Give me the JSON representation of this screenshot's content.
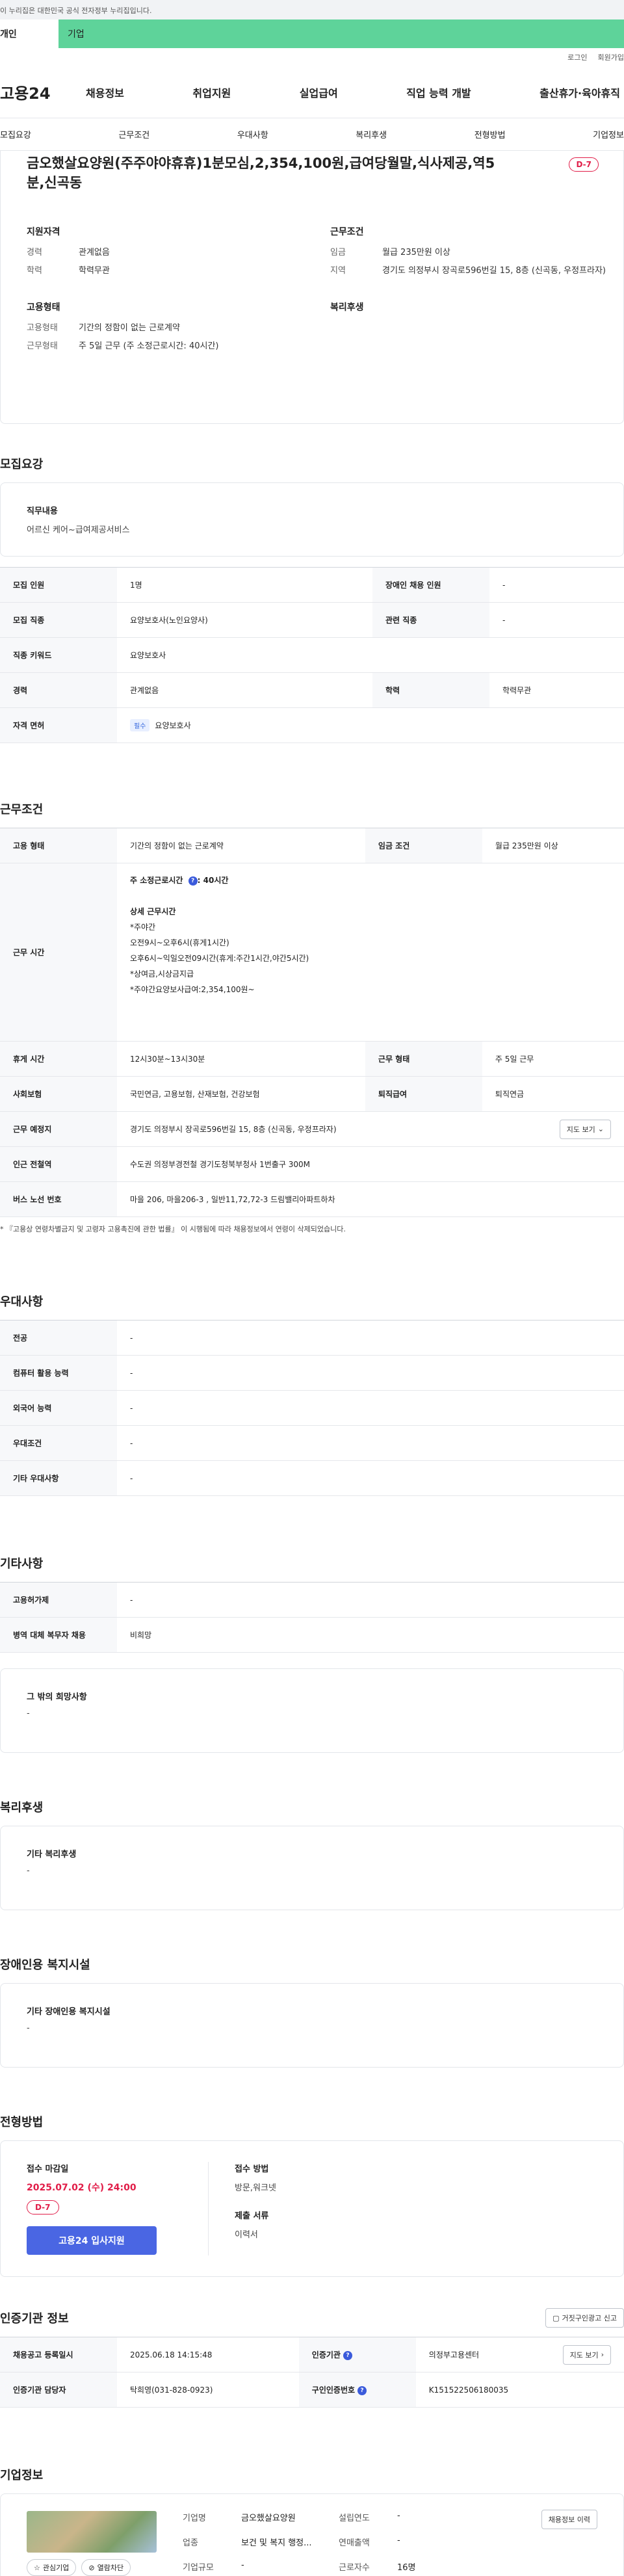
{
  "topbar": {
    "notice": "이 누리집은 대한민국 공식 전자정부 누리집입니다."
  },
  "gnb": {
    "individual": "개인",
    "corporate": "기업"
  },
  "util": {
    "login": "로그인",
    "signup": "회원가입"
  },
  "header": {
    "logo": "고용24",
    "menu": [
      "채용정보",
      "취업지원",
      "실업급여",
      "직업 능력 개발",
      "출산휴가·육아휴직"
    ]
  },
  "anchors": [
    "모집요강",
    "근무조건",
    "우대사항",
    "복리후생",
    "전형방법",
    "기업정보"
  ],
  "summary": {
    "title": "금오했살요양원(주주야야휴휴)1분모심,2,354,100원,급여당월말,식사제공,역5분,신곡동",
    "dday": "D-7",
    "qual_title": "지원자격",
    "qual": [
      {
        "k": "경력",
        "v": "관계없음"
      },
      {
        "k": "학력",
        "v": "학력무관"
      }
    ],
    "cond_title": "근무조건",
    "cond": [
      {
        "k": "임금",
        "v": "월급 235만원 이상"
      },
      {
        "k": "지역",
        "v": "경기도 의정부시 장곡로596번길 15, 8층 (신곡동, 우정프라자)"
      }
    ],
    "emp_title": "고용형태",
    "emp": [
      {
        "k": "고용형태",
        "v": "기간의 정함이 없는 근로계약"
      },
      {
        "k": "근무형태",
        "v": "주 5일 근무 (주 소정근로시간: 40시간)"
      }
    ],
    "welfare_title": "복리후생"
  },
  "recruit": {
    "section": "모집요강",
    "duty_label": "직무내용",
    "duty_value": "어르신 케어~급여제공서비스",
    "rows": {
      "count_k": "모집 인원",
      "count_v": "1명",
      "disabled_k": "장애인 채용 인원",
      "disabled_v": "-",
      "job_k": "모집 직종",
      "job_v": "요양보호사(노인요양사)",
      "related_k": "관련 직종",
      "related_v": "-",
      "kw_k": "직종 키워드",
      "kw_v": "요양보호사",
      "career_k": "경력",
      "career_v": "관계없음",
      "edu_k": "학력",
      "edu_v": "학력무관",
      "license_k": "자격 면허",
      "license_badge": "필수",
      "license_v": "요양보호사"
    }
  },
  "work": {
    "section": "근무조건",
    "emp_k": "고용 형태",
    "emp_v": "기간의 정함이 없는 근로계약",
    "wage_k": "임금 조건",
    "wage_v": "월급 235만원 이상",
    "hours_k": "근무 시간",
    "hours_week_label": "주 소정근로시간",
    "hours_week_value": ": 40시간",
    "hours_detail_title": "상세 근무시간",
    "hours_lines": [
      "*주야간",
      "오전9시~오후6시(휴게1시간)",
      "오후6시~익일오전09시간(휴게:주간1시간,야간5시간)",
      "*상여금,시상금지급",
      "*주야간요양보사급여:2,354,100원~"
    ],
    "rest_k": "휴게 시간",
    "rest_v": "12시30분~13시30분",
    "worktype_k": "근무 형태",
    "worktype_v": "주 5일 근무",
    "insurance_k": "사회보험",
    "insurance_v": "국민연금, 고용보험, 산재보험, 건강보험",
    "retire_k": "퇴직급여",
    "retire_v": "퇴직연금",
    "place_k": "근무 예정지",
    "place_v": "경기도 의정부시 장곡로596번길 15, 8층 (신곡동, 우정프라자)",
    "map_btn": "지도 보기",
    "subway_k": "인근 전철역",
    "subway_v": "수도권 의정부경전철 경기도청북부청사 1번출구 300M",
    "bus_k": "버스 노선 번호",
    "bus_v": "마을 206, 마을206-3 , 일반11,72,72-3 드림밸리아파트하차",
    "note": "* 『고용상 연령차별금지 및 고령자 고용촉진에 관한 법률』 이 시행됨에 따라 채용정보에서 연령이 삭제되었습니다."
  },
  "pref": {
    "section": "우대사항",
    "rows": [
      {
        "k": "전공",
        "v": "-"
      },
      {
        "k": "컴퓨터 활용 능력",
        "v": "-"
      },
      {
        "k": "외국어 능력",
        "v": "-"
      },
      {
        "k": "우대조건",
        "v": "-"
      },
      {
        "k": "기타 우대사항",
        "v": "-"
      }
    ]
  },
  "etc": {
    "section": "기타사항",
    "rows": [
      {
        "k": "고용허가제",
        "v": "-"
      },
      {
        "k": "병역 대체 복무자 채용",
        "v": "비희망"
      }
    ],
    "other_label": "그 밖의 희망사항",
    "other_value": "-"
  },
  "welfare": {
    "section": "복리후생",
    "label": "기타 복리후생",
    "value": "-"
  },
  "facility": {
    "section": "장애인용 복지시설",
    "label": "기타 장애인용 복지시설",
    "value": "-"
  },
  "process": {
    "section": "전형방법",
    "deadline_label": "접수 마감일",
    "deadline_value": "2025.07.02 (수) 24:00",
    "dday": "D-7",
    "apply_btn": "고용24 입사지원",
    "method_label": "접수 방법",
    "method_value": "방문,워크넷",
    "docs_label": "제출 서류",
    "docs_value": "이력서"
  },
  "cert": {
    "section": "인증기관 정보",
    "report_btn": "거짓구인광고 신고",
    "reg_k": "채용공고 등록일시",
    "reg_v": "2025.06.18 14:15:48",
    "org_k": "인증기관",
    "org_v": "의정부고용센터",
    "map_btn": "지도 보기",
    "mgr_k": "인증기관 담당자",
    "mgr_v": "탁희영(031-828-0923)",
    "no_k": "구인인증번호",
    "no_v": "K151522506180035"
  },
  "company": {
    "section": "기업정보",
    "fav_btn": "관심기업",
    "block_btn": "열람차단",
    "history_btn": "채용정보 이력",
    "name_k": "기업명",
    "name_v": "금오했살요양원",
    "founded_k": "설립연도",
    "founded_v": "-",
    "industry_k": "업종",
    "industry_v": "보건 및 복지 행정...",
    "sales_k": "연매출액",
    "sales_v": "-",
    "size_k": "기업규모",
    "size_v": "-",
    "emp_k": "근로자수",
    "emp_v": "16명"
  },
  "colors": {
    "brand": "#5ed39a",
    "accent": "#e11d48",
    "button": "#4a66e3"
  }
}
